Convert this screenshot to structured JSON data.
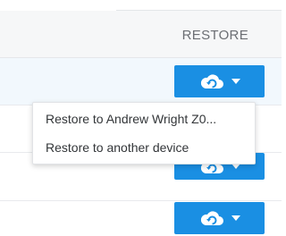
{
  "header": {
    "column_label": "RESTORE"
  },
  "restore_menu": {
    "items": [
      {
        "label": "Restore to Andrew Wright Z0..."
      },
      {
        "label": "Restore to another device"
      }
    ]
  },
  "colors": {
    "accent": "#1a8fe3",
    "row_highlight": "#f2f8fd"
  },
  "icons": {
    "restore_button": [
      "cloud-restore-icon",
      "caret-down-icon"
    ]
  }
}
